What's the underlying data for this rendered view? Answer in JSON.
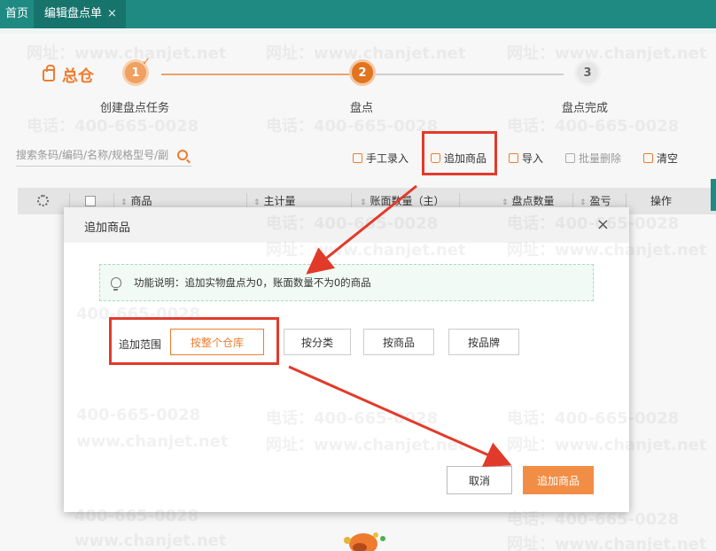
{
  "tabs": [
    {
      "label": "首页"
    },
    {
      "label": "编辑盘点单",
      "close": "×"
    }
  ],
  "warehouse": {
    "name": "总仓"
  },
  "steps": [
    {
      "number": "1",
      "label": "创建盘点任务",
      "state": "done"
    },
    {
      "number": "2",
      "label": "盘点",
      "state": "active"
    },
    {
      "number": "3",
      "label": "盘点完成",
      "state": "todo"
    }
  ],
  "search": {
    "placeholder": "搜索条码/编码/名称/规格型号/副"
  },
  "toolbar": {
    "manual_entry": "手工录入",
    "add_goods": "追加商品",
    "import": "导入",
    "batch_delete": "批量删除",
    "clear": "清空"
  },
  "table_headers": [
    "商品",
    "主计量",
    "账面数量（主）",
    "盘点数量",
    "盈亏",
    "操作"
  ],
  "modal": {
    "title": "追加商品",
    "close": "×",
    "info": "功能说明：追加实物盘点为0，账面数量不为0的商品",
    "range_label": "追加范围",
    "range_options": [
      "按整个仓库",
      "按分类",
      "按商品",
      "按品牌"
    ],
    "selected_range": "按整个仓库",
    "cancel": "取消",
    "confirm": "追加商品"
  },
  "watermark": {
    "phone": "电话：400-665-0028",
    "phone_short": "400-665-0028",
    "site": "网址：www.chanjet.net",
    "site_short": "www.chanjet.net"
  },
  "colors": {
    "accent": "#ef7c2e",
    "teal": "#1f8a82",
    "annotation_red": "#e23a2a"
  }
}
